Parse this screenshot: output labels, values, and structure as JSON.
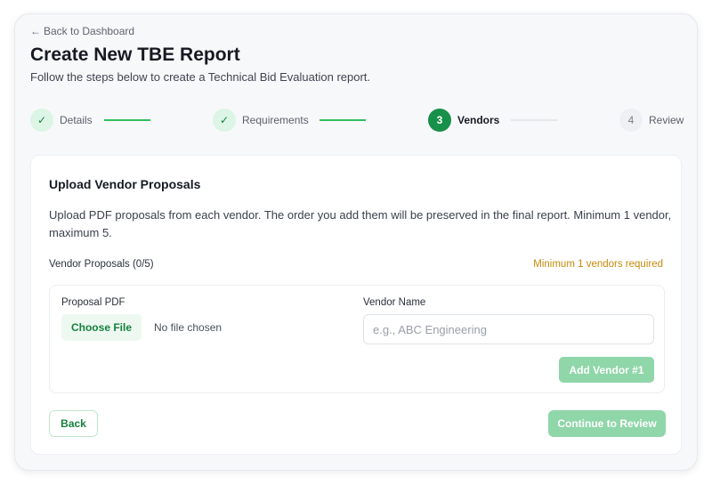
{
  "header": {
    "back_link": "Back to Dashboard",
    "title": "Create New TBE Report",
    "subtitle": "Follow the steps below to create a Technical Bid Evaluation report."
  },
  "stepper": {
    "steps": [
      {
        "marker": "✓",
        "label": "Details",
        "state": "done"
      },
      {
        "marker": "✓",
        "label": "Requirements",
        "state": "done"
      },
      {
        "marker": "3",
        "label": "Vendors",
        "state": "active"
      },
      {
        "marker": "4",
        "label": "Review",
        "state": "pending"
      }
    ]
  },
  "card": {
    "title": "Upload Vendor Proposals",
    "description": "Upload PDF proposals from each vendor. The order you add them will be preserved in the final report. Minimum 1 vendor, maximum 5.",
    "proposals_label": "Vendor Proposals (0/5)",
    "min_warning": "Minimum 1 vendors required",
    "form": {
      "pdf_label": "Proposal PDF",
      "choose_file": "Choose File",
      "no_file": "No file chosen",
      "vendor_label": "Vendor Name",
      "vendor_placeholder": "e.g., ABC Engineering",
      "vendor_value": "",
      "add_button": "Add Vendor #1"
    },
    "back_button": "Back",
    "continue_button": "Continue to Review"
  },
  "colors": {
    "accent": "#17904a",
    "accent_disabled": "#8fd6a9",
    "warning": "#c48a0c"
  }
}
